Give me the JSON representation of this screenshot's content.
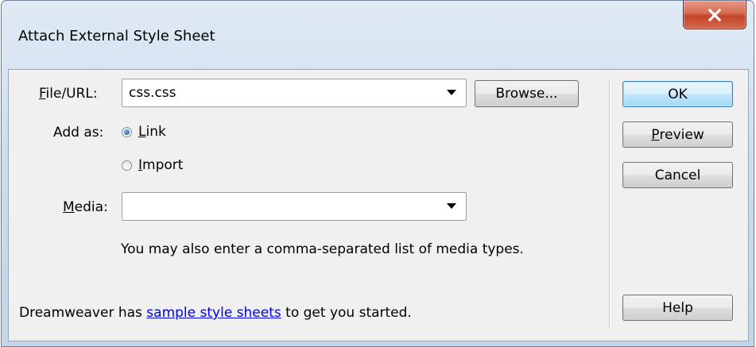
{
  "window": {
    "title": "Attach External Style Sheet",
    "close_glyph": "X"
  },
  "form": {
    "file_url": {
      "label_mnemonic": "F",
      "label_rest": "ile/URL:",
      "value": "css.css"
    },
    "add_as": {
      "label": "Add as:",
      "options": [
        {
          "mnemonic": "L",
          "rest": "ink",
          "checked": true
        },
        {
          "mnemonic": "I",
          "rest": "mport",
          "checked": false
        }
      ]
    },
    "media": {
      "label_mnemonic": "M",
      "label_rest": "edia:",
      "value": ""
    },
    "hint": "You may also enter a comma-separated list of media types."
  },
  "buttons": {
    "browse": "Browse...",
    "ok": "OK",
    "preview_mnemonic": "P",
    "preview_rest": "review",
    "cancel": "Cancel",
    "help": "Help"
  },
  "footer": {
    "prefix": "Dreamweaver has ",
    "link": "sample style sheets",
    "suffix": " to get you started."
  },
  "colors": {
    "title_gradient_top": "#dfeaf5",
    "close_button_red": "#c3442a",
    "default_button_blue": "#a7d9f5",
    "link_blue": "#0000ee",
    "client_bg": "#f0f0f0"
  }
}
